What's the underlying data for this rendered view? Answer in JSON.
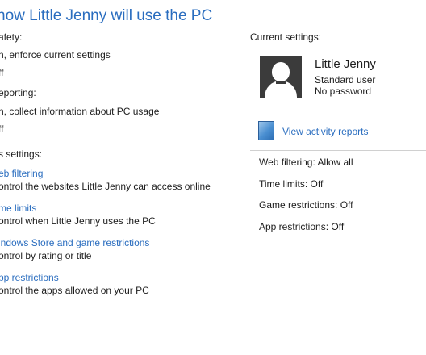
{
  "page": {
    "title": "how Little Jenny will use the PC"
  },
  "left": {
    "family_safety_label": "afety:",
    "family_safety_on": "n, enforce current settings",
    "family_safety_off": "ff",
    "activity_reporting_label": "eporting:",
    "activity_reporting_on": "n, collect information about PC usage",
    "activity_reporting_off": "ff",
    "settings_label": "s settings:",
    "settings": [
      {
        "link": "eb filtering",
        "desc": "ontrol the websites Little Jenny can access online"
      },
      {
        "link": "me limits",
        "desc": "ontrol when Little Jenny uses the PC"
      },
      {
        "link": "indows Store and game restrictions",
        "desc": "ontrol by rating or title"
      },
      {
        "link": "pp restrictions",
        "desc": "ontrol the apps allowed on your PC"
      }
    ]
  },
  "right": {
    "current_settings_label": "Current settings:",
    "user": {
      "name": "Little Jenny",
      "account_type": "Standard user",
      "password": "No password"
    },
    "view_reports_link": "View activity reports",
    "stats": {
      "web_filtering": "Web filtering: Allow all",
      "time_limits": "Time limits: Off",
      "game_restrictions": "Game restrictions: Off",
      "app_restrictions": "App restrictions: Off"
    }
  },
  "icons": {
    "avatar": "user-avatar-icon",
    "report": "activity-report-icon"
  },
  "colors": {
    "link": "#2a6dbf",
    "text": "#1e1e1e",
    "avatar_bg": "#3b3b3b"
  }
}
